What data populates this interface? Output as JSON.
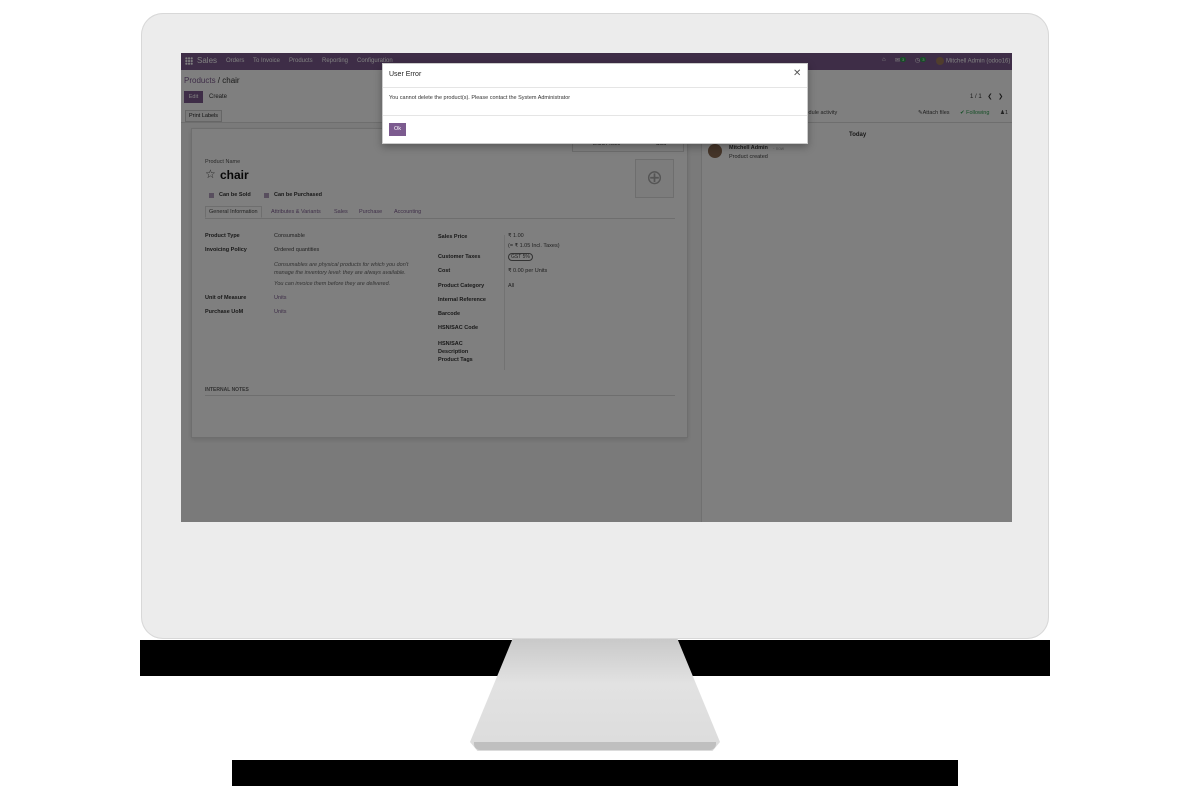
{
  "navbar": {
    "brand": "Sales",
    "menu": [
      "Orders",
      "To Invoice",
      "Products",
      "Reporting",
      "Configuration"
    ],
    "messages_count": "3",
    "activities_count": "3",
    "user": "Mitchell Admin (odoo16)"
  },
  "breadcrumb": {
    "parent": "Products",
    "separator": " / ",
    "current": "chair"
  },
  "actions": {
    "edit": "Edit",
    "create": "Create",
    "print_labels": "Print Labels"
  },
  "pager": {
    "value": "1 / 1"
  },
  "smart_buttons": {
    "extra_prices": "Extra Prices",
    "sold": "Sold"
  },
  "form": {
    "product_name_label": "Product Name",
    "product_name": "chair",
    "can_be_sold": "Can be Sold",
    "can_be_purchased": "Can be Purchased",
    "tabs": [
      "General Information",
      "Attributes & Variants",
      "Sales",
      "Purchase",
      "Accounting"
    ],
    "product_type_label": "Product Type",
    "product_type": "Consumable",
    "invoicing_policy_label": "Invoicing Policy",
    "invoicing_policy": "Ordered quantities",
    "help_consumable": "Consumables are physical products for which you don't manage the inventory level: they are always available.",
    "help_invoice": "You can invoice them before they are delivered.",
    "uom_label": "Unit of Measure",
    "uom": "Units",
    "purchase_uom_label": "Purchase UoM",
    "purchase_uom": "Units",
    "sales_price_label": "Sales Price",
    "sales_price": "₹ 1.00",
    "incl_taxes": "(= ₹ 1.05 Incl. Taxes)",
    "customer_taxes_label": "Customer Taxes",
    "customer_taxes": "GST 5%",
    "cost_label": "Cost",
    "cost": "₹ 0.00 per Units",
    "category_label": "Product Category",
    "category": "All",
    "internal_ref_label": "Internal Reference",
    "barcode_label": "Barcode",
    "hsn_code_label": "HSN/SAC Code",
    "hsn_desc_label": "HSN/SAC Description",
    "tags_label": "Product Tags",
    "internal_notes": "INTERNAL NOTES"
  },
  "chatter": {
    "schedule_activity": "Schedule activity",
    "attach_files": "Attach files",
    "following": "Following",
    "followers": "1",
    "today": "Today",
    "author": "Mitchell Admin",
    "ago": "- now",
    "message": "Product created"
  },
  "dialog": {
    "title": "User Error",
    "body": "You cannot delete the product(s). Please contact the System Administrator",
    "ok": "Ok"
  },
  "colors": {
    "brand": "#7c5b8f",
    "following": "#2e9e4f"
  }
}
